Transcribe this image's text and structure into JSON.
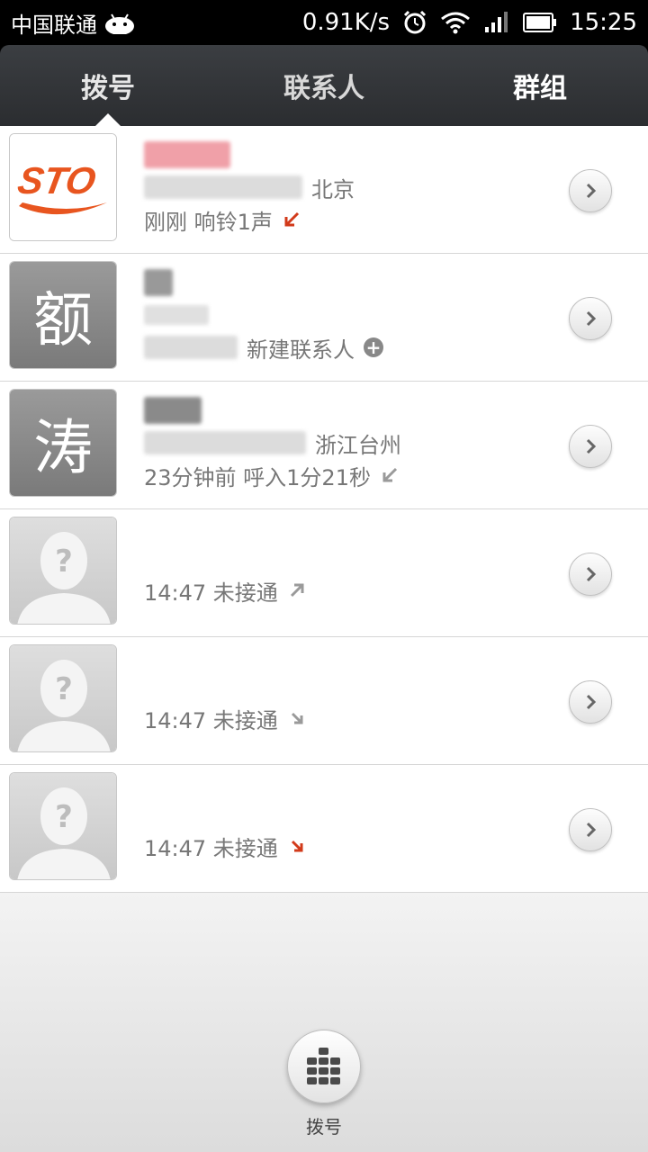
{
  "status_bar": {
    "carrier": "中国联通",
    "net_speed": "0.91K/s",
    "time": "15:25"
  },
  "tabs": [
    {
      "label": "拨号",
      "active": true
    },
    {
      "label": "联系人",
      "active": false
    },
    {
      "label": "群组",
      "active": false
    }
  ],
  "calls": [
    {
      "avatar_type": "logo",
      "logo_text": "STO",
      "location": "北京",
      "status": "刚刚 响铃1声",
      "direction": "missed-incoming",
      "dir_color": "#d23a1a"
    },
    {
      "avatar_type": "letter",
      "letter": "额",
      "action": "新建联系人",
      "direction": "none"
    },
    {
      "avatar_type": "letter",
      "letter": "涛",
      "location": "浙江台州",
      "status": "23分钟前 呼入1分21秒",
      "direction": "incoming",
      "dir_color": "#9a9a9a"
    },
    {
      "avatar_type": "unknown",
      "status": "14:47 未接通",
      "direction": "outgoing",
      "dir_color": "#9a9a9a"
    },
    {
      "avatar_type": "unknown",
      "status": "14:47 未接通",
      "direction": "down-small",
      "dir_color": "#9a9a9a"
    },
    {
      "avatar_type": "unknown",
      "status": "14:47 未接通",
      "direction": "down-small",
      "dir_color": "#d23a1a"
    }
  ],
  "bottom": {
    "dialpad_label": "拨号"
  },
  "colors": {
    "accent_red": "#d23a1a",
    "tab_bar": "#2f3236",
    "sto_orange": "#e8551f"
  }
}
